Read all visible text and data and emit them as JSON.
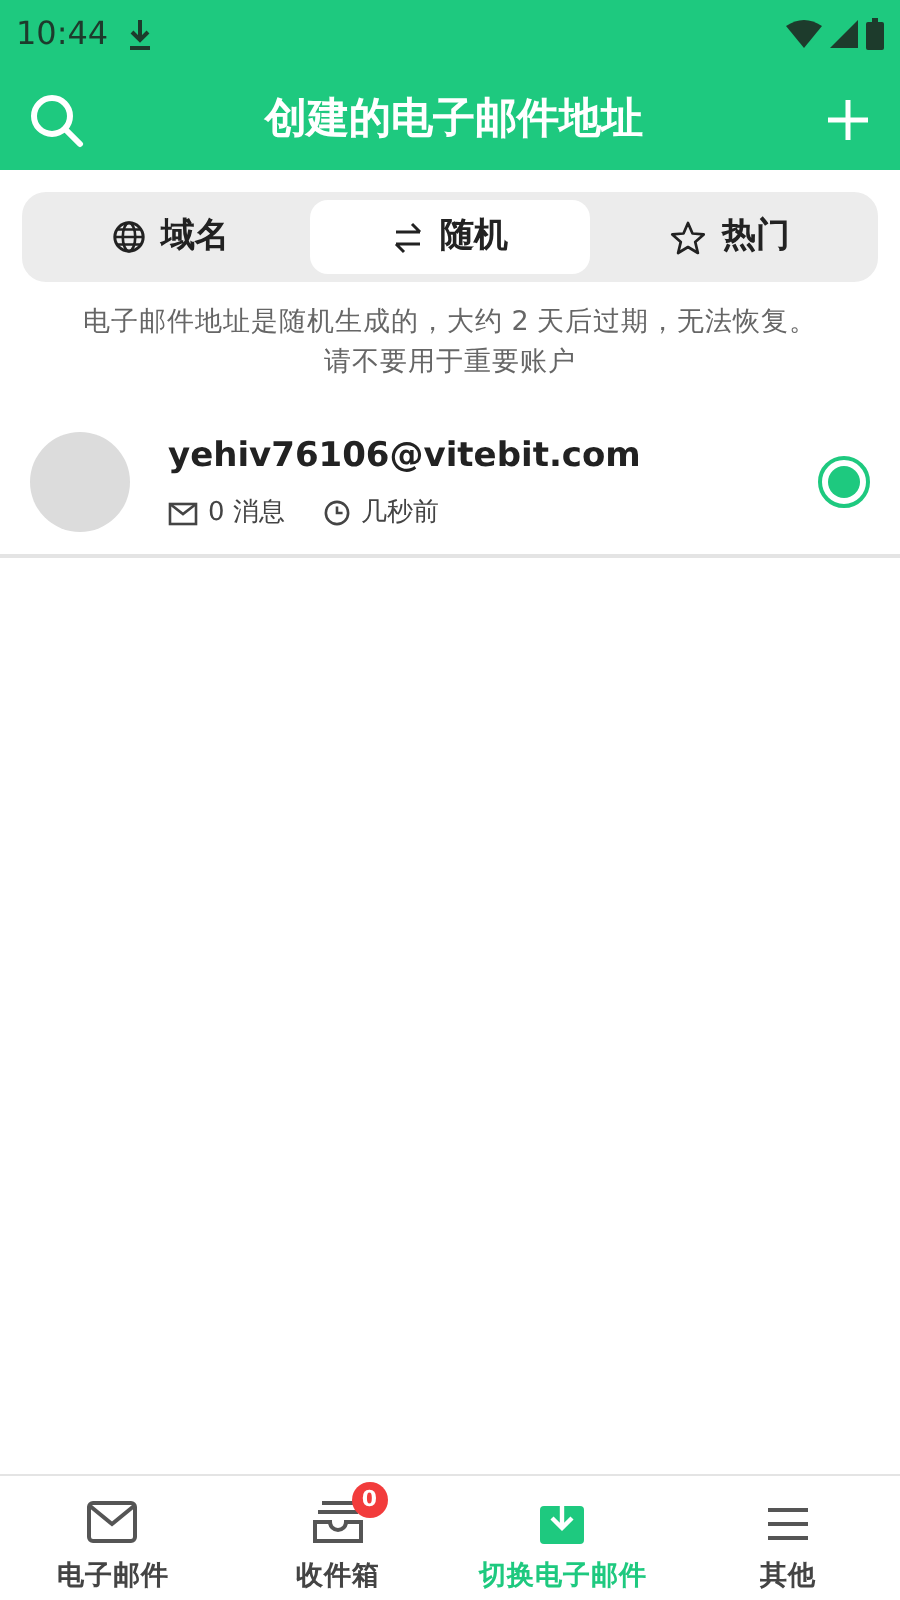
{
  "status_bar": {
    "time": "10:44"
  },
  "header": {
    "title": "创建的电子邮件地址"
  },
  "tabs": [
    {
      "label": "域名",
      "kind": "globe",
      "selected": false
    },
    {
      "label": "随机",
      "kind": "swap",
      "selected": true
    },
    {
      "label": "热门",
      "kind": "star",
      "selected": false
    }
  ],
  "notice": [
    "电子邮件地址是随机生成的，大约 2 天后过期，无法恢复。",
    "请不要用于重要账户"
  ],
  "addresses": [
    {
      "email": "yehiv76106@vitebit.com",
      "messages": "0 消息",
      "time": "几秒前",
      "selected": true
    }
  ],
  "bottom_nav": [
    {
      "label": "电子邮件",
      "kind": "mail",
      "selected": false
    },
    {
      "label": "收件箱",
      "kind": "inbox",
      "selected": false,
      "badge": "0"
    },
    {
      "label": "切换电子邮件",
      "kind": "switch",
      "selected": true
    },
    {
      "label": "其他",
      "kind": "more",
      "selected": false
    }
  ]
}
